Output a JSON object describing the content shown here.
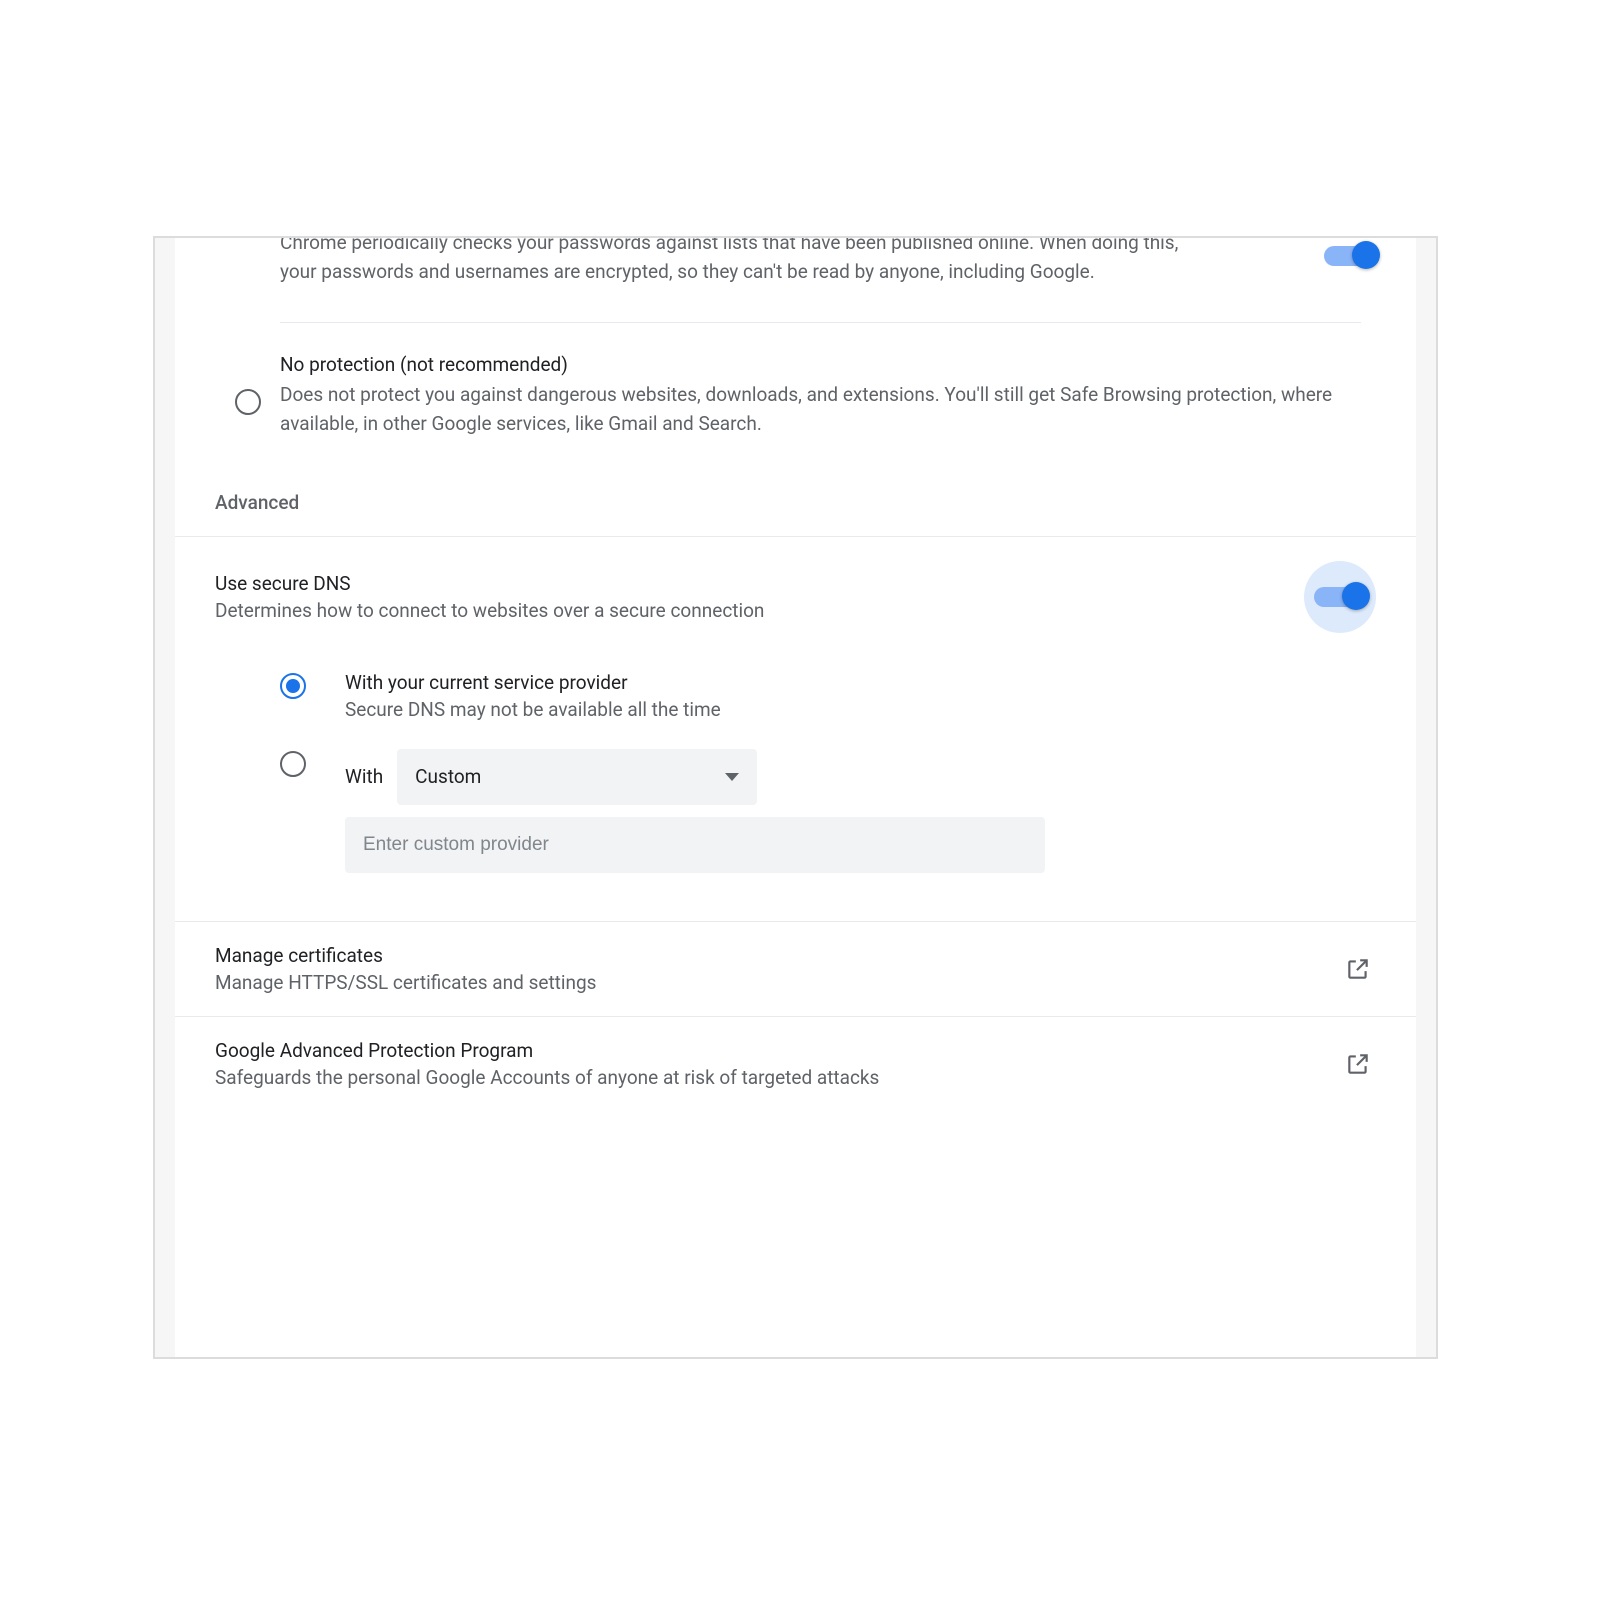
{
  "password_check": {
    "description": "Chrome periodically checks your passwords against lists that have been published online. When doing this, your passwords and usernames are encrypted, so they can't be read by anyone, including Google.",
    "enabled": true
  },
  "no_protection": {
    "title": "No protection (not recommended)",
    "description": "Does not protect you against dangerous websites, downloads, and extensions. You'll still get Safe Browsing protection, where available, in other Google services, like Gmail and Search.",
    "selected": false
  },
  "section_advanced": "Advanced",
  "secure_dns": {
    "title": "Use secure DNS",
    "description": "Determines how to connect to websites over a secure connection",
    "enabled": true,
    "options": {
      "current_provider": {
        "title": "With your current service provider",
        "description": "Secure DNS may not be available all the time",
        "selected": true
      },
      "custom": {
        "label": "With",
        "dropdown_value": "Custom",
        "input_placeholder": "Enter custom provider",
        "selected": false
      }
    }
  },
  "manage_certificates": {
    "title": "Manage certificates",
    "description": "Manage HTTPS/SSL certificates and settings"
  },
  "advanced_protection": {
    "title": "Google Advanced Protection Program",
    "description": "Safeguards the personal Google Accounts of anyone at risk of targeted attacks"
  }
}
